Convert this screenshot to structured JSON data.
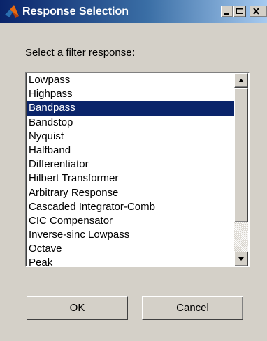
{
  "window": {
    "title": "Response Selection",
    "icon": "matlab-logo-icon",
    "controls": [
      "minimize-icon",
      "maximize-icon",
      "close-icon"
    ]
  },
  "prompt": "Select a filter response:",
  "list": {
    "selected_index": 2,
    "items": [
      "Lowpass",
      "Highpass",
      "Bandpass",
      "Bandstop",
      "Nyquist",
      "Halfband",
      "Differentiator",
      "Hilbert Transformer",
      "Arbitrary Response",
      "Cascaded Integrator-Comb",
      "CIC Compensator",
      "Inverse-sinc Lowpass",
      "Octave",
      "Peak"
    ]
  },
  "buttons": {
    "ok": "OK",
    "cancel": "Cancel"
  },
  "colors": {
    "titlebar_start": "#0a246a",
    "titlebar_end": "#a6caf0",
    "selection": "#0a246a",
    "face": "#d4d0c8"
  }
}
